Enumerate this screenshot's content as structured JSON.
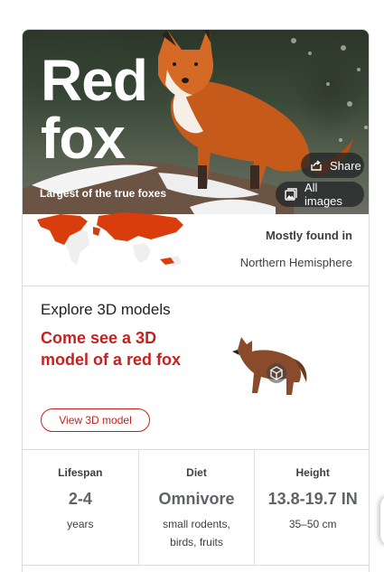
{
  "hero": {
    "title_line1": "Red",
    "title_line2": "fox",
    "subtitle": "Largest of the true foxes",
    "share_label": "Share",
    "all_images_label": "All images"
  },
  "range": {
    "label": "Mostly found in",
    "value": "Northern Hemisphere"
  },
  "explore": {
    "heading": "Explore 3D models",
    "promo": "Come see a 3D model of a red fox",
    "button_label": "View 3D model"
  },
  "stats": [
    {
      "label": "Lifespan",
      "value": "2-4",
      "sub": "years"
    },
    {
      "label": "Diet",
      "value": "Omnivore",
      "sub": "small rodents, birds, fruits"
    },
    {
      "label": "Height",
      "value": "13.8-19.7 IN",
      "sub": "35–50 cm"
    }
  ],
  "colors": {
    "accent": "#c5221f",
    "range_fill": "#d93d0d",
    "divider": "#dadce0"
  },
  "icons": {
    "share": "share-icon",
    "images": "images-icon",
    "cube": "3d-cube-icon"
  }
}
